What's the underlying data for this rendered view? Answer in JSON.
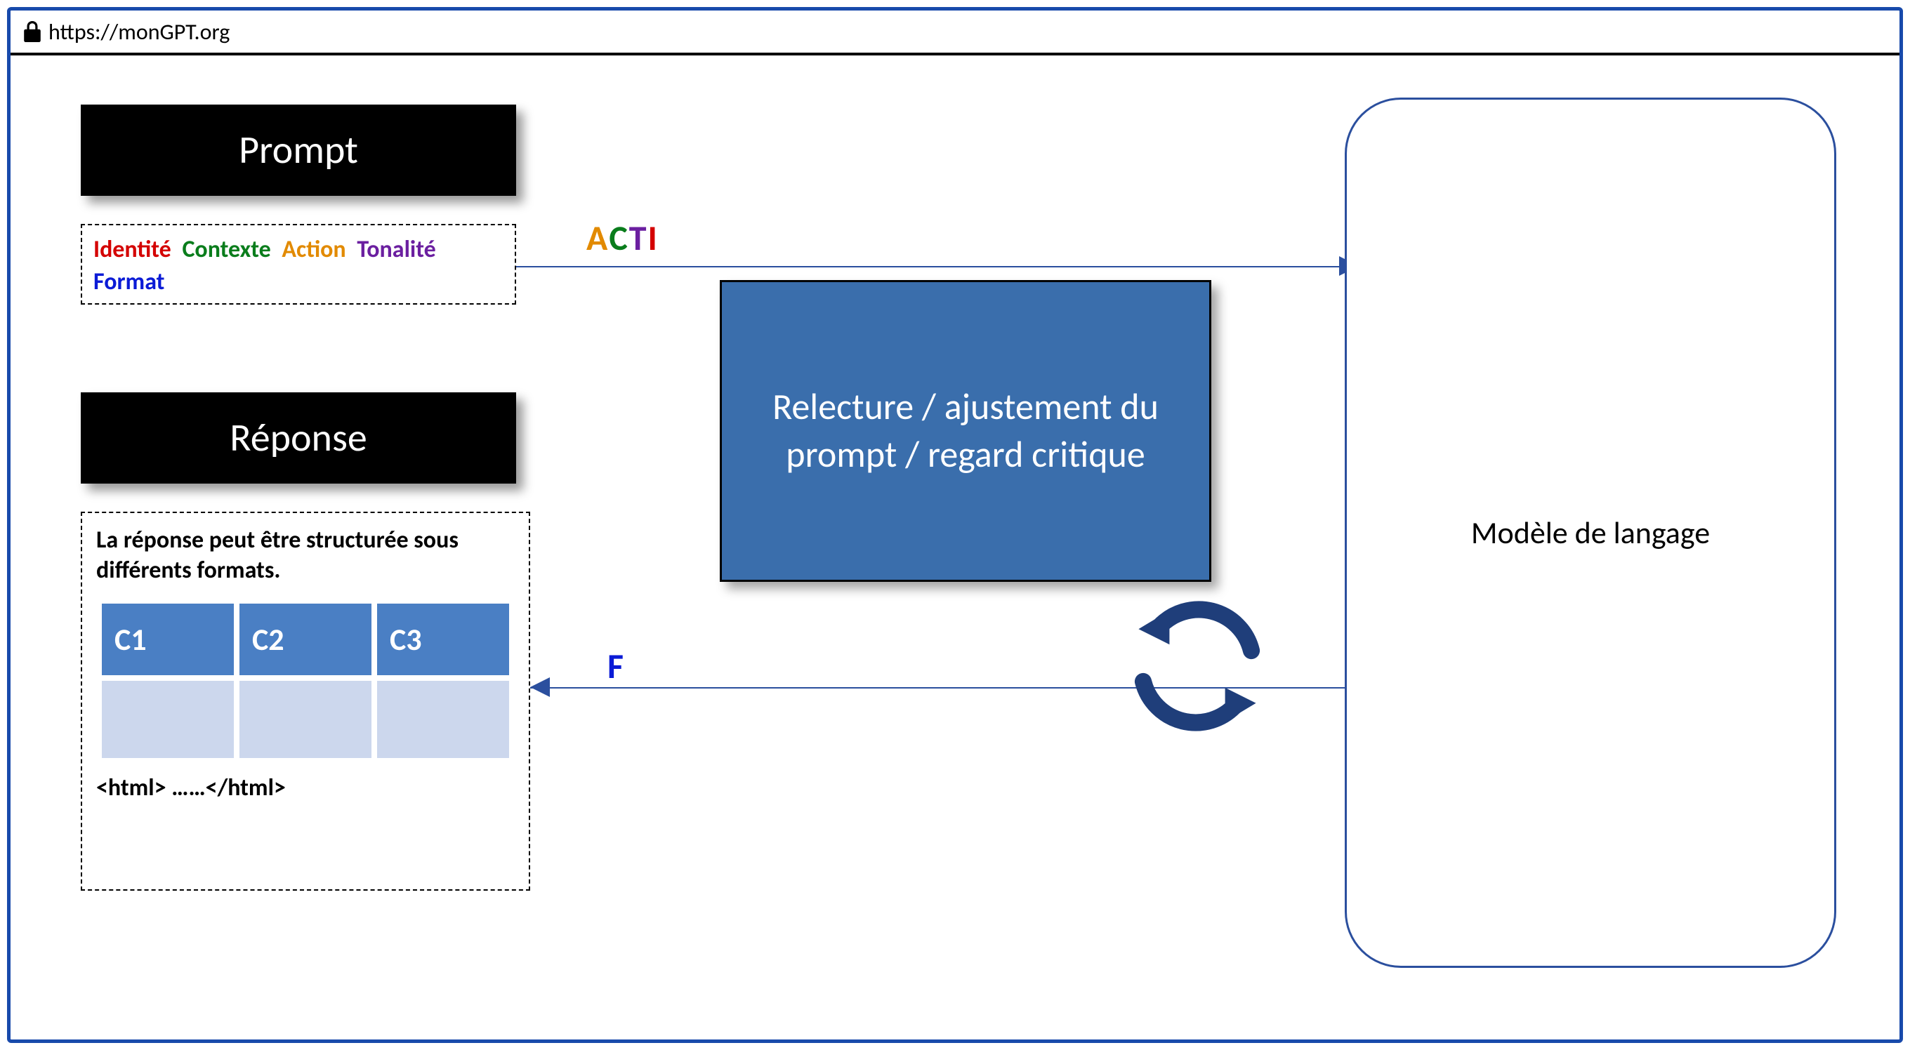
{
  "url": "https://monGPT.org",
  "left": {
    "prompt_title": "Prompt",
    "palette": {
      "identite": {
        "text": "Identité",
        "color": "#d40000"
      },
      "contexte": {
        "text": "Contexte",
        "color": "#0a7d1c"
      },
      "action": {
        "text": "Action",
        "color": "#e28a00"
      },
      "tonalite": {
        "text": "Tonalité",
        "color": "#6b1fa0"
      },
      "format": {
        "text": "Format",
        "color": "#0b1bd6"
      }
    },
    "reponse_title": "Réponse",
    "reponse_desc": "La réponse peut être structurée sous différents formats.",
    "table_headers": {
      "c1": "C1",
      "c2": "C2",
      "c3": "C3"
    },
    "html_sample": "<html> ……</html>"
  },
  "arrows": {
    "acti": {
      "a": {
        "char": "A",
        "color": "#e28a00"
      },
      "c": {
        "char": "C",
        "color": "#0a7d1c"
      },
      "t": {
        "char": "T",
        "color": "#6b1fa0"
      },
      "i": {
        "char": "I",
        "color": "#d40000"
      }
    },
    "f_label": "F"
  },
  "center": {
    "review_text": "Relecture / ajustement du prompt / regard critique"
  },
  "right": {
    "model_label": "Modèle de langage"
  },
  "colors": {
    "border_blue": "#184aab",
    "box_blue": "#3a6eac",
    "header_blue": "#4a7fc4",
    "cell_blue": "#ccd7ed",
    "arrow_blue": "#2b4f9e",
    "cycle_blue": "#1f3e7a"
  }
}
